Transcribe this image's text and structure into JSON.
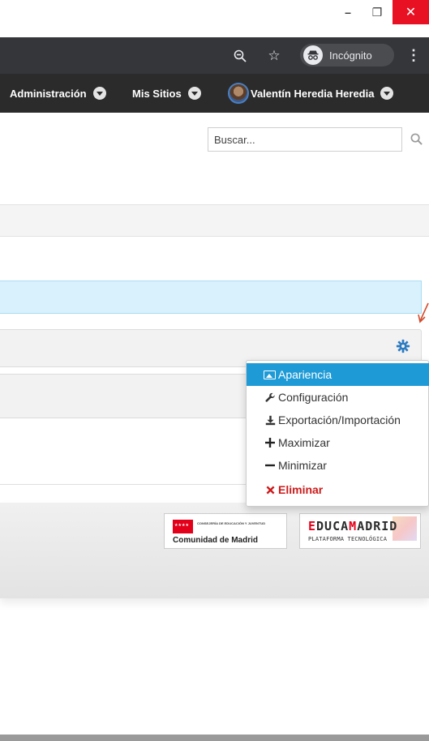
{
  "window": {
    "minimize_glyph": "–",
    "restore_glyph": "❐",
    "close_glyph": "✕"
  },
  "browser": {
    "zoom_icon": "zoom-out-icon",
    "star_icon": "bookmark-star-icon",
    "incognito_label": "Incógnito",
    "menu_icon": "more-vert-icon"
  },
  "sitenav": {
    "admin_label": "Administración",
    "sites_label": "Mis Sitios",
    "user_label": "Valentín Heredia Heredia"
  },
  "search": {
    "placeholder": "Buscar..."
  },
  "portlet": {
    "gear_icon": "gear-icon"
  },
  "menu": {
    "items": [
      {
        "label": "Apariencia",
        "icon": "image-icon",
        "active": true
      },
      {
        "label": "Configuración",
        "icon": "wrench-icon"
      },
      {
        "label": "Exportación/Importación",
        "icon": "download-icon"
      },
      {
        "label": "Maximizar",
        "icon": "plus-icon"
      },
      {
        "label": "Minimizar",
        "icon": "minus-icon"
      },
      {
        "label": "Eliminar",
        "icon": "close-icon",
        "danger": true
      }
    ]
  },
  "footer": {
    "cm_small": "CONSEJERÍA DE EDUCACIÓN Y JUVENTUD",
    "cm_name": "Comunidad de Madrid",
    "em_title_a": "E",
    "em_title_b": "DUCA",
    "em_title_c": "M",
    "em_title_d": "ADRID",
    "em_sub": "PLATAFORMA TECNOLÓGICA"
  },
  "colors": {
    "nav_bg": "#2b2b2b",
    "toolbar_bg": "#35363a",
    "menu_active": "#1e9ad6",
    "danger": "#cc1b1b",
    "info_bg": "#d9f1fc",
    "close_red": "#e81123"
  }
}
